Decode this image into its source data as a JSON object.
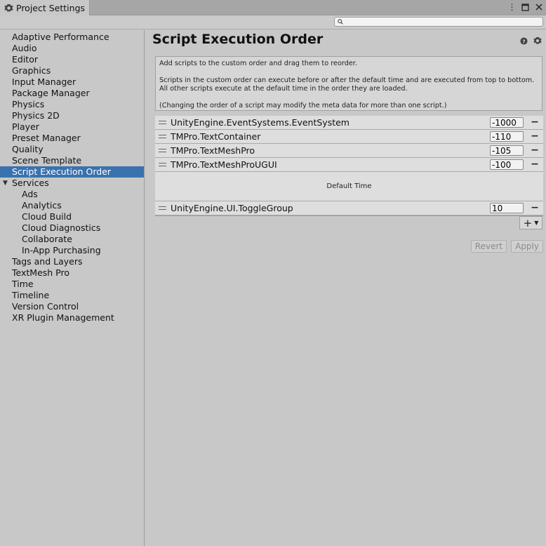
{
  "window": {
    "tab_title": "Project Settings",
    "tab_icon": "gear-icon",
    "controls": [
      "more-icon",
      "maximize-icon",
      "close-icon"
    ]
  },
  "search": {
    "value": "",
    "placeholder": ""
  },
  "sidebar": {
    "items": [
      {
        "label": "Adaptive Performance",
        "level": 0
      },
      {
        "label": "Audio",
        "level": 0
      },
      {
        "label": "Editor",
        "level": 0
      },
      {
        "label": "Graphics",
        "level": 0
      },
      {
        "label": "Input Manager",
        "level": 0
      },
      {
        "label": "Package Manager",
        "level": 0
      },
      {
        "label": "Physics",
        "level": 0
      },
      {
        "label": "Physics 2D",
        "level": 0
      },
      {
        "label": "Player",
        "level": 0
      },
      {
        "label": "Preset Manager",
        "level": 0
      },
      {
        "label": "Quality",
        "level": 0
      },
      {
        "label": "Scene Template",
        "level": 0
      },
      {
        "label": "Script Execution Order",
        "level": 0,
        "selected": true
      },
      {
        "label": "Services",
        "level": 0,
        "expanded": true
      },
      {
        "label": "Ads",
        "level": 1
      },
      {
        "label": "Analytics",
        "level": 1
      },
      {
        "label": "Cloud Build",
        "level": 1
      },
      {
        "label": "Cloud Diagnostics",
        "level": 1
      },
      {
        "label": "Collaborate",
        "level": 1
      },
      {
        "label": "In-App Purchasing",
        "level": 1
      },
      {
        "label": "Tags and Layers",
        "level": 0
      },
      {
        "label": "TextMesh Pro",
        "level": 0
      },
      {
        "label": "Time",
        "level": 0
      },
      {
        "label": "Timeline",
        "level": 0
      },
      {
        "label": "Version Control",
        "level": 0
      },
      {
        "label": "XR Plugin Management",
        "level": 0
      }
    ]
  },
  "main": {
    "title": "Script Execution Order",
    "help": {
      "line1": "Add scripts to the custom order and drag them to reorder.",
      "line2": "Scripts in the custom order can execute before or after the default time and are executed from top to bottom.",
      "line3": "All other scripts execute at the default time in the order they are loaded.",
      "line4": "(Changing the order of a script may modify the meta data for more than one script.)"
    },
    "scripts_before": [
      {
        "name": "UnityEngine.EventSystems.EventSystem",
        "order": "-1000"
      },
      {
        "name": "TMPro.TextContainer",
        "order": "-110"
      },
      {
        "name": "TMPro.TextMeshPro",
        "order": "-105"
      },
      {
        "name": "TMPro.TextMeshProUGUI",
        "order": "-100"
      }
    ],
    "default_time_label": "Default Time",
    "scripts_after": [
      {
        "name": "UnityEngine.UI.ToggleGroup",
        "order": "10"
      }
    ],
    "add_label": "+",
    "revert_label": "Revert",
    "apply_label": "Apply"
  },
  "colors": {
    "selection": "#3a72b0",
    "background": "#c8c8c8",
    "disabled_text": "#8c8c8c"
  }
}
